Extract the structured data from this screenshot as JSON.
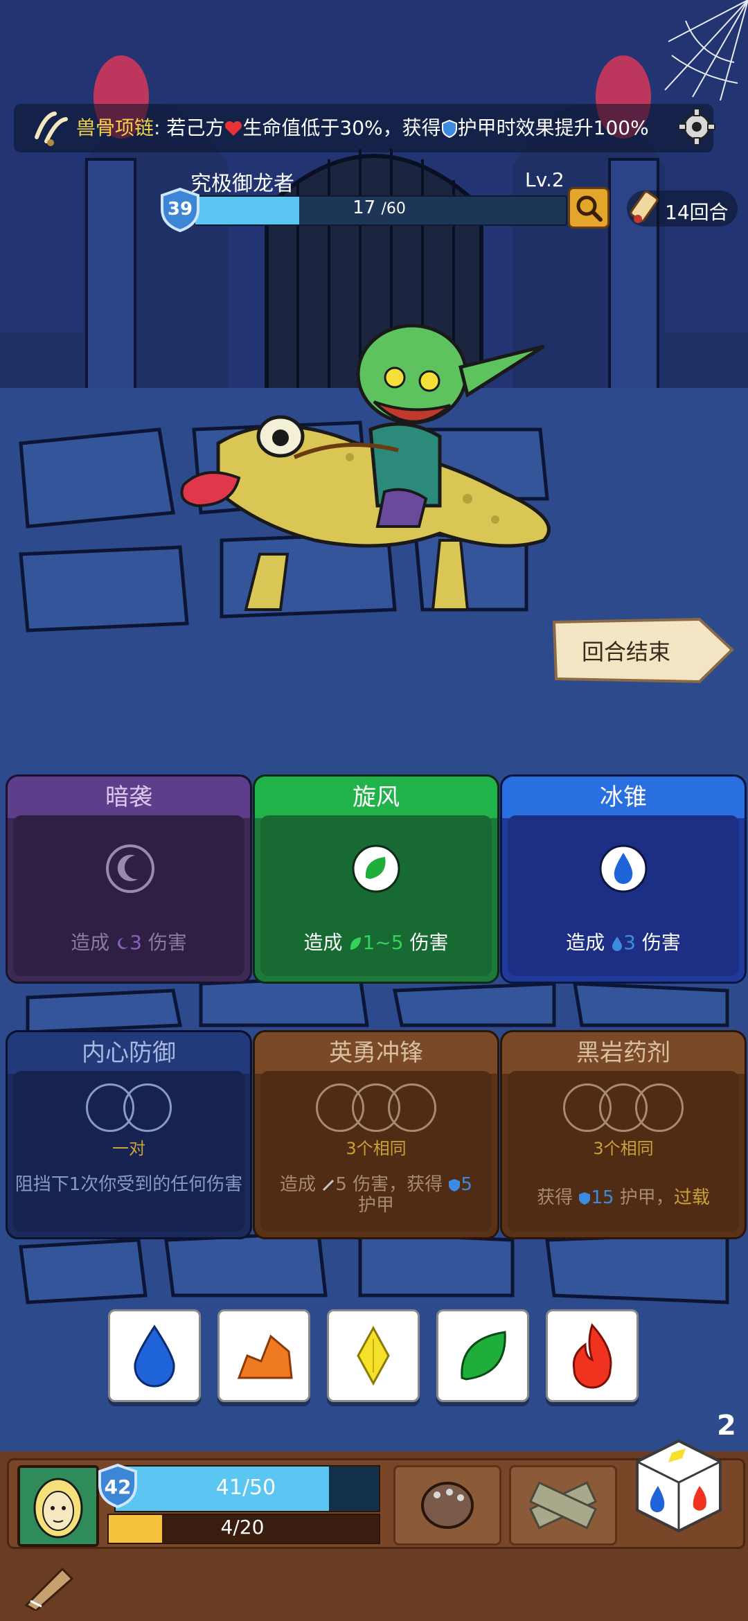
{
  "relic": {
    "name": "兽骨项链",
    "separator": ":",
    "desc_part1": "若己方",
    "desc_part2": "生命值低于30%，获得",
    "desc_part3": "护甲时效果提升100%",
    "icon": "bone-necklace-icon"
  },
  "enemy": {
    "name": "究极御龙者",
    "level": "Lv.2",
    "armor": "39",
    "hp_text": "17",
    "hp_max_text": "/60",
    "hp_value": 17,
    "hp_max": 60
  },
  "turn": {
    "label": "14回合"
  },
  "end_turn": {
    "label": "回合结束"
  },
  "cards_row1": [
    {
      "title": "暗袭",
      "prefix": "造成",
      "amount": "3",
      "suffix": "伤害",
      "icon": "moon-icon",
      "color": "#8a62b8"
    },
    {
      "title": "旋风",
      "prefix": "造成",
      "amount": "1~5",
      "suffix": "伤害",
      "icon": "leaf-icon",
      "color": "#22b24a"
    },
    {
      "title": "冰锥",
      "prefix": "造成",
      "amount": "3",
      "suffix": "伤害",
      "icon": "water-drop-icon",
      "color": "#2a6fe0"
    }
  ],
  "cards_row2": [
    {
      "title": "内心防御",
      "tag": "一对",
      "desc": "阻挡下1次你受到的任何伤害"
    },
    {
      "title": "英勇冲锋",
      "tag": "3个相同",
      "desc_part1": "造成",
      "desc_amount1": "5",
      "desc_part2": "伤害，获得",
      "desc_amount2": "5",
      "desc_part3": "护甲"
    },
    {
      "title": "黑岩药剂",
      "tag": "3个相同",
      "desc_part1": "获得",
      "desc_amount1": "15",
      "desc_part2": "护甲，",
      "desc_keyword": "过载"
    }
  ],
  "dice": [
    {
      "icon": "water-drop-icon",
      "color": "#1f63d8"
    },
    {
      "icon": "rock-icon",
      "color": "#f07a22"
    },
    {
      "icon": "diamond-icon",
      "color": "#f5e02a"
    },
    {
      "icon": "leaf-icon",
      "color": "#1fae3a"
    },
    {
      "icon": "fire-icon",
      "color": "#f0331f"
    }
  ],
  "player": {
    "armor": "42",
    "hp_text": "41/50",
    "hp_value": 41,
    "hp_max": 50,
    "xp_text": "4/20",
    "xp_value": 4,
    "xp_max": 20
  },
  "reroll": {
    "count": "2"
  },
  "colors": {
    "hp_bar": "#5bc6f2",
    "xp_bar": "#f5c23a",
    "relic_name": "#f2d04a"
  }
}
